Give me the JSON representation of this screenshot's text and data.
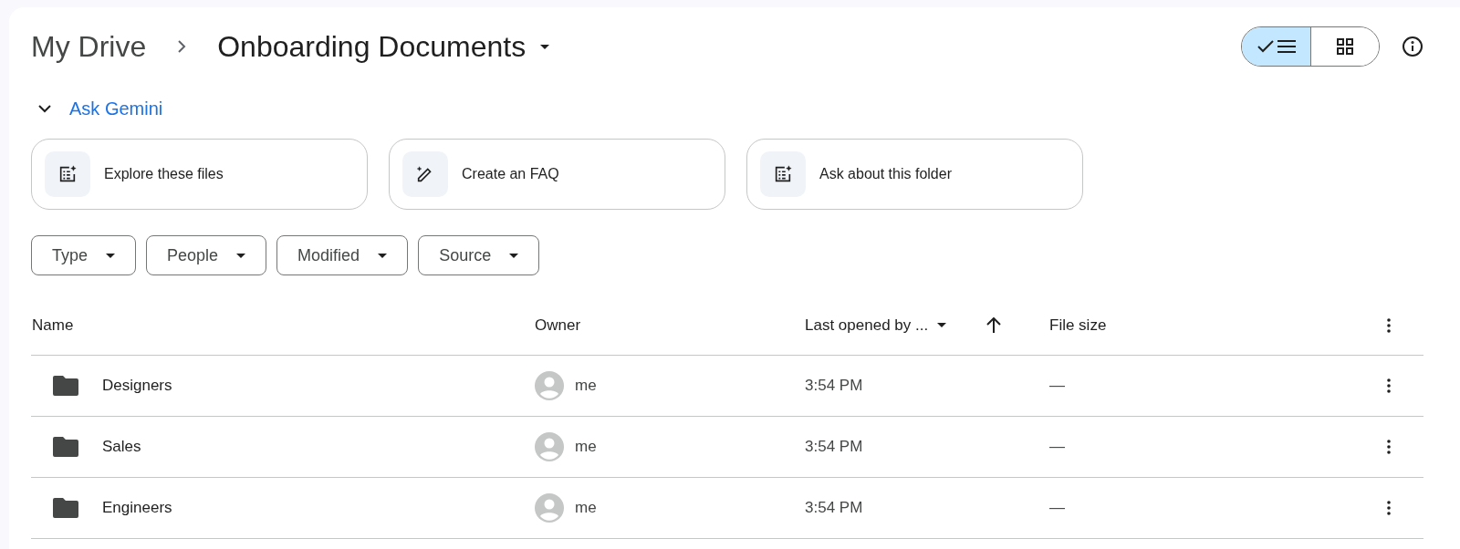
{
  "breadcrumb": {
    "parent": "My Drive",
    "current": "Onboarding Documents"
  },
  "view_toggle": [
    {
      "kind": "list",
      "selected": true
    },
    {
      "kind": "grid",
      "selected": false
    }
  ],
  "gemini": {
    "title": "Ask Gemini",
    "expanded": true,
    "suggestions": [
      {
        "kind": "doc",
        "label": "Explore these files"
      },
      {
        "kind": "pen",
        "label": "Create an FAQ"
      },
      {
        "kind": "doc",
        "label": "Ask about this folder"
      }
    ]
  },
  "filters": [
    "Type",
    "People",
    "Modified",
    "Source"
  ],
  "table": {
    "columns": {
      "name": "Name",
      "owner": "Owner",
      "last_opened": "Last opened by ...",
      "file_size": "File size"
    },
    "rows": [
      {
        "name": "Designers",
        "owner": "me",
        "last_opened": "3:54 PM",
        "file_size": "—"
      },
      {
        "name": "Sales",
        "owner": "me",
        "last_opened": "3:54 PM",
        "file_size": "—"
      },
      {
        "name": "Engineers",
        "owner": "me",
        "last_opened": "3:54 PM",
        "file_size": "—"
      }
    ]
  }
}
